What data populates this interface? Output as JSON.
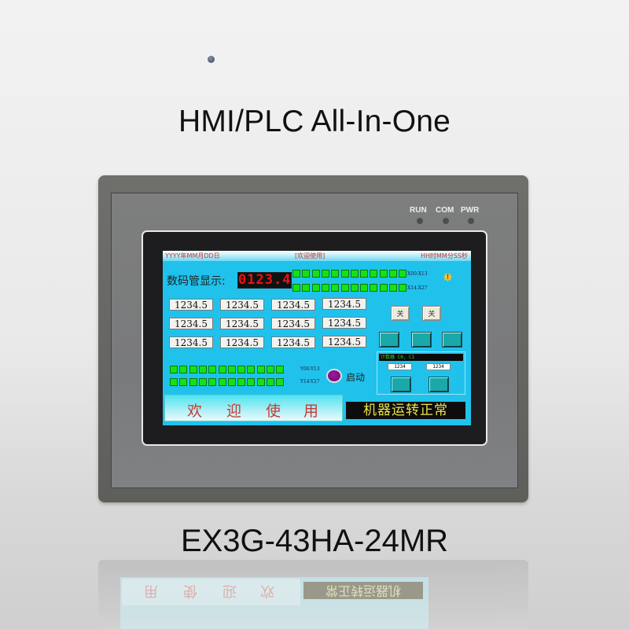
{
  "headline": "HMI/PLC All-In-One",
  "model": "EX3G-43HA-24MR",
  "indicators": [
    {
      "label": "RUN",
      "state": "off"
    },
    {
      "label": "COM",
      "state": "off"
    },
    {
      "label": "PWR",
      "state": "off"
    }
  ],
  "screen": {
    "topbar": {
      "date": "YYYY年MM月DD日",
      "title": "[欢迎使用]",
      "time": "HH时MM分SS秒"
    },
    "segment_label": "数码管显示:",
    "segment_value": "0123.4",
    "input_lamp_rows": [
      {
        "label": "X00-X13",
        "states": [
          1,
          1,
          1,
          1,
          1,
          1,
          1,
          1,
          1,
          1,
          1,
          1
        ]
      },
      {
        "label": "X14-X27",
        "states": [
          1,
          1,
          1,
          1,
          1,
          1,
          1,
          1,
          1,
          1,
          1,
          1
        ]
      }
    ],
    "output_lamp_rows": [
      {
        "label": "Y00-Y13",
        "states": [
          1,
          1,
          1,
          1,
          1,
          1,
          1,
          1,
          1,
          1,
          1,
          1
        ]
      },
      {
        "label": "Y14-Y27",
        "states": [
          1,
          1,
          1,
          1,
          1,
          1,
          1,
          1,
          1,
          1,
          1,
          1
        ]
      }
    ],
    "alarm_icon": "warning-burst-icon",
    "numeric_displays": [
      [
        "1234.5",
        "1234.5",
        "1234.5",
        "1234.5"
      ],
      [
        "1234.5",
        "1234.5",
        "1234.5",
        "1234.5"
      ],
      [
        "1234.5",
        "1234.5",
        "1234.5",
        "1234.5"
      ]
    ],
    "toggle_buttons": [
      "关",
      "关"
    ],
    "counter": {
      "title": "计数器 C0, C1",
      "values": [
        "1234",
        "1234"
      ]
    },
    "start_button_label": "启动",
    "welcome_chars": [
      "欢",
      "迎",
      "使",
      "用"
    ],
    "status_text": "机器运转正常"
  },
  "colors": {
    "screen_bg": "#20c2ec",
    "lamp_on": "#16e016",
    "segment": "#ee1111",
    "status_text": "#e9e24a",
    "welcome_text": "#c83a30",
    "start_button": "#8a1290"
  }
}
